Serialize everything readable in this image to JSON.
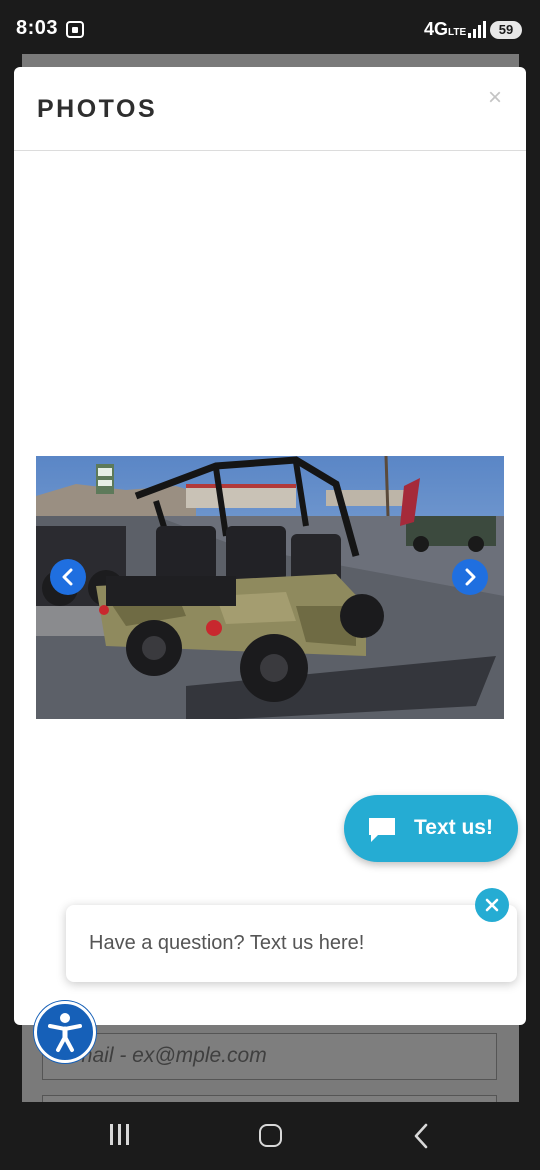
{
  "status_bar": {
    "time": "8:03",
    "network": "4G",
    "network_sub": "LTE",
    "battery": "59"
  },
  "modal": {
    "title": "PHOTOS",
    "close_label": "×"
  },
  "carousel": {
    "prev_icon": "chevron-left-icon",
    "next_icon": "chevron-right-icon",
    "arrow_color": "#1f6fe0"
  },
  "textus": {
    "button_label": "Text us!",
    "bubble_text": "Have a question? Text us here!",
    "accent_color": "#25acd3"
  },
  "background_form": {
    "email_placeholder": "Email - ex@mple.com"
  },
  "accessibility": {
    "icon": "accessibility-icon",
    "color": "#1660b8"
  }
}
